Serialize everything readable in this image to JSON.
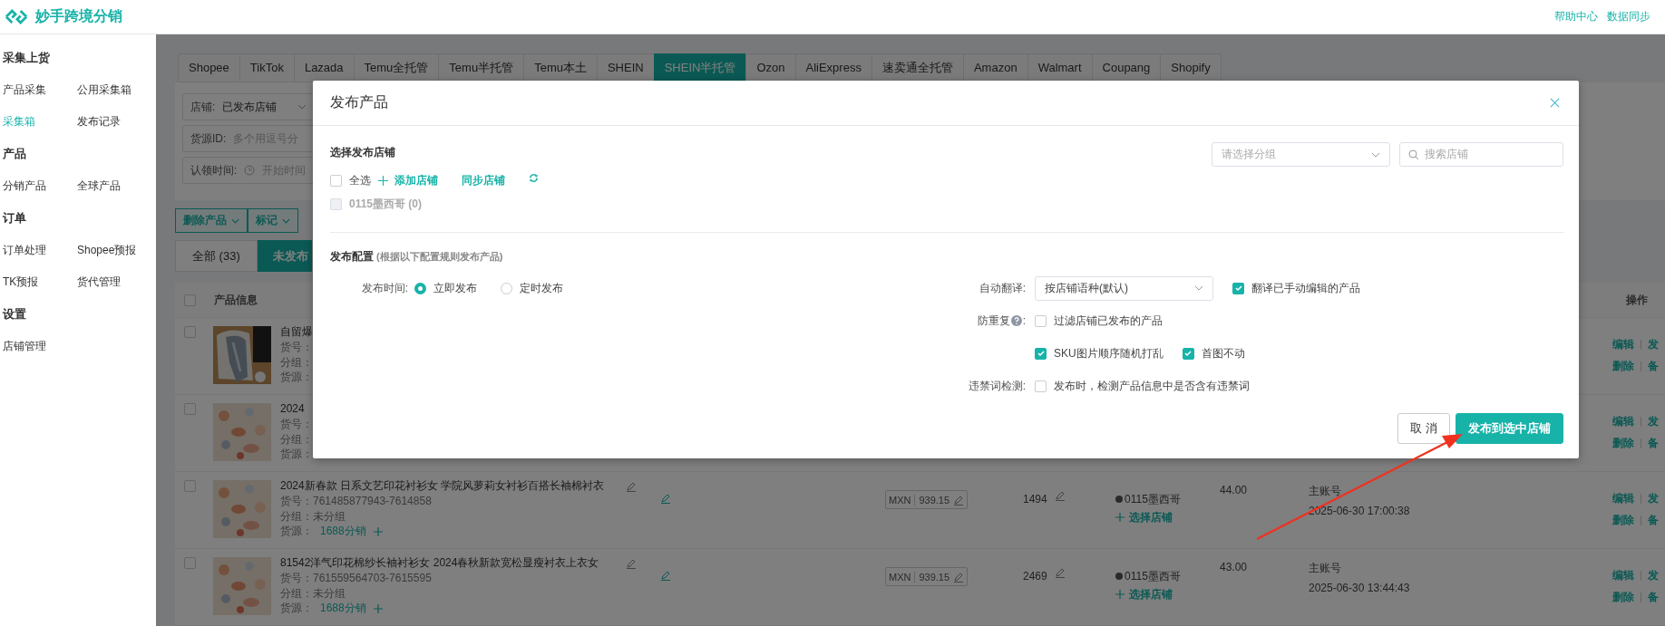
{
  "app": {
    "title": "妙手跨境分销",
    "links": [
      "帮助中心",
      "数据同步"
    ]
  },
  "sidebar": {
    "groups": [
      {
        "title": "采集上货",
        "items": [
          {
            "label": "产品采集",
            "selected": false
          },
          {
            "label": "公用采集箱",
            "selected": false
          },
          {
            "label": "采集箱",
            "selected": true
          },
          {
            "label": "发布记录",
            "selected": false
          }
        ]
      },
      {
        "title": "产品",
        "items": [
          {
            "label": "分销产品",
            "selected": false
          },
          {
            "label": "全球产品",
            "selected": false
          }
        ]
      },
      {
        "title": "订单",
        "items": [
          {
            "label": "订单处理",
            "selected": false
          },
          {
            "label": "Shopee预报",
            "selected": false
          },
          {
            "label": "TK预报",
            "selected": false
          },
          {
            "label": "货代管理",
            "selected": false
          }
        ]
      },
      {
        "title": "设置",
        "items": [
          {
            "label": "店铺管理",
            "selected": false
          }
        ]
      }
    ]
  },
  "platform_tabs": [
    {
      "label": "Shopee",
      "selected": false
    },
    {
      "label": "TikTok",
      "selected": false
    },
    {
      "label": "Lazada",
      "selected": false
    },
    {
      "label": "Temu全托管",
      "selected": false
    },
    {
      "label": "Temu半托管",
      "selected": false
    },
    {
      "label": "Temu本土",
      "selected": false
    },
    {
      "label": "SHEIN",
      "selected": false
    },
    {
      "label": "SHEIN半托管",
      "selected": true
    },
    {
      "label": "Ozon",
      "selected": false
    },
    {
      "label": "AliExpress",
      "selected": false
    },
    {
      "label": "速卖通全托管",
      "selected": false
    },
    {
      "label": "Amazon",
      "selected": false
    },
    {
      "label": "Walmart",
      "selected": false
    },
    {
      "label": "Coupang",
      "selected": false
    },
    {
      "label": "Shopify",
      "selected": false
    }
  ],
  "filters": [
    {
      "kind": "dropdown",
      "label": "店铺:",
      "value": "已发布店铺"
    },
    {
      "kind": "input",
      "label": "货源ID:",
      "placeholder": "多个用逗号分"
    },
    {
      "kind": "date",
      "label": "认领时间:",
      "placeholder": "开始时间"
    }
  ],
  "bulk_actions": [
    "删除产品",
    "标记"
  ],
  "status_tabs": [
    {
      "label": "全部 (33)",
      "selected": false
    },
    {
      "label": "未发布",
      "selected": true
    }
  ],
  "table": {
    "columns": [
      "产品信息",
      "操作"
    ],
    "all_checked": false,
    "rows": [
      {
        "checked": false,
        "title": "自留爆",
        "sku_line": "货号：",
        "group_line": "分组：",
        "source_label": "货源：",
        "actions": [
          "编辑",
          "发",
          "删除",
          "备"
        ]
      },
      {
        "checked": false,
        "title": "2024",
        "sku_line": "货号：",
        "group_line": "分组：",
        "source_label": "货源：",
        "actions": [
          "编辑",
          "发",
          "删除",
          "备"
        ]
      },
      {
        "checked": false,
        "title": "2024新春款 日系文艺印花衬衫女 学院风萝莉女衬衫百搭长袖棉衬衣",
        "sku_line": "货号：761485877943-7614858",
        "group_line": "分组：未分组",
        "source_label": "货源：",
        "source_link": "1688分销",
        "currency": "MXN",
        "price": "939.15",
        "stock": "1494",
        "store": "0115墨西哥",
        "store_action": "选择店铺",
        "cost": "44.00",
        "account": "主账号",
        "time": "2025-06-30 17:00:38",
        "actions": [
          "编辑",
          "发",
          "删除",
          "备"
        ]
      },
      {
        "checked": false,
        "title": "81542洋气印花棉纱长袖衬衫女 2024春秋新款宽松显瘦衬衣上衣女",
        "sku_line": "货号：761559564703-7615595",
        "group_line": "分组：未分组",
        "source_label": "货源：",
        "source_link": "1688分销",
        "currency": "MXN",
        "price": "939.15",
        "stock": "2469",
        "store": "0115墨西哥",
        "store_action": "选择店铺",
        "cost": "43.00",
        "account": "主账号",
        "time": "2025-06-30 13:44:43",
        "actions": [
          "编辑",
          "发",
          "删除",
          "备"
        ]
      }
    ]
  },
  "dialog": {
    "title": "发布产品",
    "store_section": {
      "title": "选择发布店铺",
      "group_select": {
        "placeholder": "请选择分组"
      },
      "search": {
        "placeholder": "搜索店铺"
      },
      "select_all": {
        "label": "全选",
        "checked": false
      },
      "add_store": "添加店铺",
      "sync_store": "同步店铺",
      "stores": [
        {
          "label": "0115墨西哥 (0)",
          "checked": false,
          "disabled": true
        }
      ]
    },
    "config": {
      "title": "发布配置",
      "note": "(根据以下配置规则发布产品)",
      "publish_time": {
        "label": "发布时间:",
        "options": [
          {
            "label": "立即发布",
            "selected": true
          },
          {
            "label": "定时发布",
            "selected": false
          }
        ]
      },
      "translate": {
        "label": "自动翻译:",
        "value": "按店铺语种(默认)",
        "option": {
          "label": "翻译已手动编辑的产品",
          "checked": true
        }
      },
      "dedupe": {
        "label": "防重复",
        "colon": ":",
        "rows": [
          {
            "options": [
              {
                "label": "过滤店铺已发布的产品",
                "checked": false
              }
            ]
          },
          {
            "options": [
              {
                "label": "SKU图片顺序随机打乱",
                "checked": true
              },
              {
                "label": "首图不动",
                "checked": true
              }
            ]
          }
        ]
      },
      "banned_words": {
        "label": "违禁词检测:",
        "option": {
          "label": "发布时，检测产品信息中是否含有违禁词",
          "checked": false
        }
      }
    },
    "buttons": [
      {
        "kind": "secondary",
        "label": "取 消"
      },
      {
        "kind": "primary",
        "label": "发布到选中店铺"
      }
    ]
  }
}
